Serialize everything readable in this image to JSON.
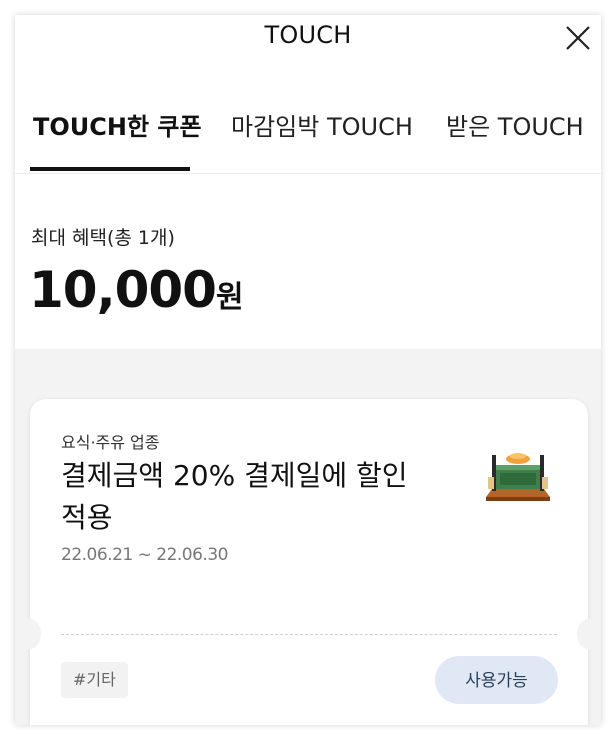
{
  "header": {
    "title": "TOUCH",
    "close_icon": "close-icon"
  },
  "tabs": [
    {
      "label": "TOUCH한 쿠폰",
      "active": true
    },
    {
      "label": "마감임박 TOUCH",
      "active": false
    },
    {
      "label": "받은 TOUCH",
      "active": false
    }
  ],
  "summary": {
    "label": "최대 혜택(총 1개)",
    "amount": "10,000",
    "unit": "원"
  },
  "coupon": {
    "category": "요식·주유 업종",
    "title": "결제금액 20% 결제일에 할인 적용",
    "period": "22.06.21 ~ 22.06.30",
    "tag": "#기타",
    "status_button": "사용가능",
    "thumbnail_icon": "food-stand-icon"
  },
  "colors": {
    "accent_underline": "#111111",
    "list_background": "#f3f3f3",
    "status_button_bg": "#dfe8f4",
    "status_button_text": "#2b3e59"
  }
}
